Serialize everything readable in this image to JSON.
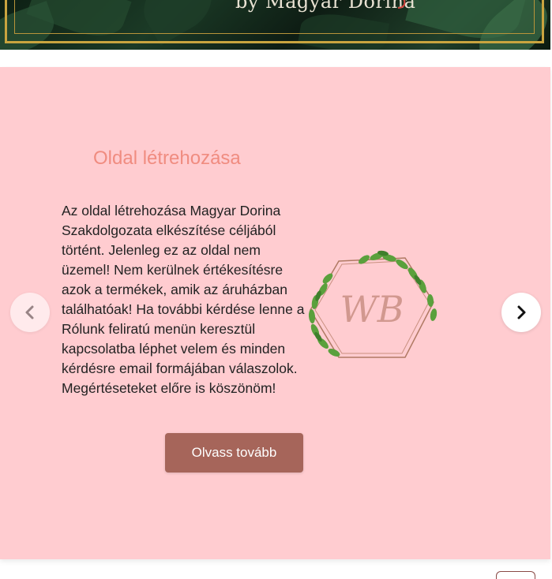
{
  "header_banner": {
    "byline": "by Magyar Dorina",
    "colors": {
      "gold_frame": "#c9a43f",
      "background": "#12261a"
    }
  },
  "carousel": {
    "slide": {
      "title": "Oldal létrehozása",
      "body": "Az oldal létrehozása Magyar Dorina Szakdolgozata elkészítése céljából történt. Jelenleg ez az oldal nem üzemel! Nem kerülnek értékesítésre azok a termékek, amik az áruházban találhatóak! Ha további kérdése lenne a Rólunk feliratú menün keresztül kapcsolatba léphet velem és minden kérdésre email formájában válaszolok. Megértéseteket előre is köszönöm!",
      "logo_text": "WB",
      "button_label": "Olvass tovább"
    },
    "prev_icon": "chevron-left-icon",
    "next_icon": "chevron-right-icon",
    "colors": {
      "background": "#ffccd0",
      "title": "#f08c80",
      "button": "#a6655a",
      "logo_frame": "#b07a64",
      "leaves": "#5aa03c"
    }
  }
}
